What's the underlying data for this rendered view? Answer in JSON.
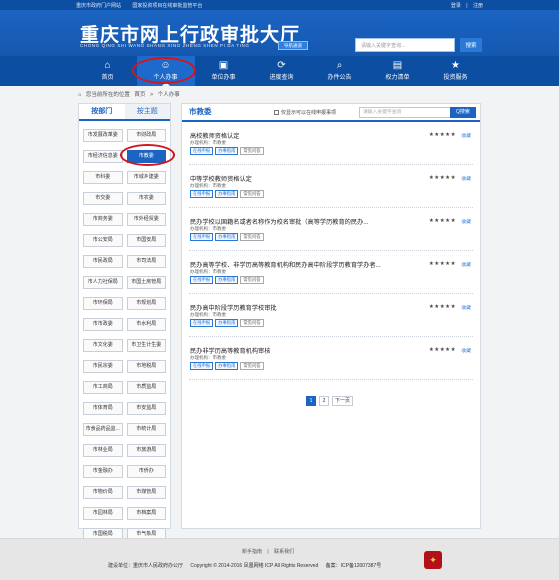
{
  "topbar": {
    "links": [
      "重庆市政府门户网站",
      "国家投资项目在线审批监管平台"
    ],
    "login": "登录",
    "sep": "|",
    "register": "注册"
  },
  "header": {
    "title_cn": "重庆市网上行政审批大厅",
    "title_en": "CHONG QING SHI WANG SHANG XING ZHENG SHEN PI DA TING",
    "fast_button": "导航通道",
    "search_placeholder": "请输入关键字查询...",
    "search_button": "搜索"
  },
  "nav": {
    "items": [
      {
        "label": "首页",
        "icon": "home-icon"
      },
      {
        "label": "个人办事",
        "icon": "person-icon"
      },
      {
        "label": "单位办事",
        "icon": "briefcase-icon"
      },
      {
        "label": "进度查询",
        "icon": "progress-icon"
      },
      {
        "label": "办件公告",
        "icon": "announcement-icon"
      },
      {
        "label": "权力清单",
        "icon": "list-icon"
      },
      {
        "label": "投资服务",
        "icon": "star-icon"
      }
    ],
    "active_index": 1
  },
  "breadcrumb": {
    "prefix": "您当前所在的位置",
    "items": [
      "首页",
      ">",
      "个人办事"
    ]
  },
  "left": {
    "tabs": [
      "按部门",
      "按主题"
    ],
    "active_tab": 0,
    "departments": [
      "市发展改革委",
      "市财政局",
      "市经济信息委",
      "市教委",
      "市科委",
      "市城乡建委",
      "市交委",
      "市农委",
      "市商务委",
      "市外经贸委",
      "市公安局",
      "市国安局",
      "市民政局",
      "市司法局",
      "市人力社保局",
      "市国土房管局",
      "市环保局",
      "市规划局",
      "市市政委",
      "市水利局",
      "市文化委",
      "市卫生计生委",
      "市民宗委",
      "市地税局",
      "市工商局",
      "市质监局",
      "市体育局",
      "市安监局",
      "市食品药品监...",
      "市统计局",
      "市林业局",
      "市旅游局",
      "市金融办",
      "市侨办",
      "市物价局",
      "市煤管局",
      "市园林局",
      "市档案局",
      "市国税局",
      "市气象局",
      "市地震局",
      "市粮食局"
    ],
    "active_department": 3
  },
  "right": {
    "title": "市教委",
    "checkbox_label": "仅显示可以在线申报事项",
    "search_placeholder": "请输入关键字查询",
    "search_button": "Q搜索",
    "items": [
      {
        "title": "高校教师资格认定",
        "org": "办理机构：市教委"
      },
      {
        "title": "中等学校教师资格认定",
        "org": "办理机构：市教委"
      },
      {
        "title": "民办学校以国籍名或者名称作为校名审批（高等学历教育的民办...",
        "org": "办理机构：市教委"
      },
      {
        "title": "民办高等学校、非学历高等教育机构和民办高中阶段学历教育学办者...",
        "org": "办理机构：市教委"
      },
      {
        "title": "民办高中阶段学历教育学校审批",
        "org": "办理机构：市教委"
      },
      {
        "title": "民办非学历高等教育机构审核",
        "org": "办理机构：市教委"
      }
    ],
    "tags": [
      "在线申报",
      "办事指南",
      "常见问答"
    ],
    "stars": "★★★★★",
    "fav_label": "收藏",
    "pager": [
      "1",
      "2",
      "下一页"
    ],
    "pager_active": 0
  },
  "footer": {
    "links": [
      "新手指南",
      "|",
      "联系我们"
    ],
    "sponsor": "建设单位：重庆市人民政府办公厅",
    "copyright": "Copyright © 2014-2016 凤凰网络 ICP All Rights Reserved",
    "icp": "备案：ICP备12007387号"
  },
  "colors": {
    "primary": "#0c4ea2",
    "accent": "#1b64c2",
    "highlight_circle": "#d4161c"
  }
}
